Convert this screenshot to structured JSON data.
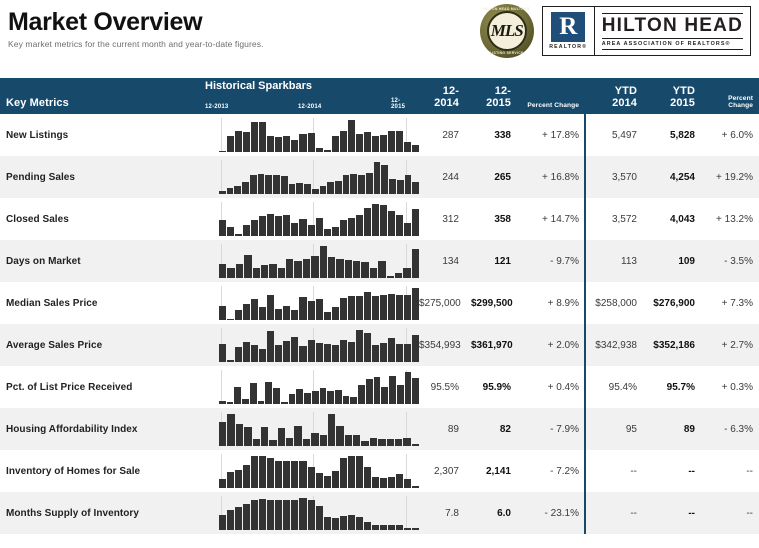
{
  "header": {
    "title": "Market Overview",
    "subtitle": "Key market metrics for the current month and year-to-date figures.",
    "logos": {
      "mls_seal": {
        "letters": "MLS",
        "top_text": "HILTON HEAD MULTIPLE",
        "bottom_text": "LISTING SERVICE"
      },
      "realtor": {
        "mark_letter": "R",
        "mark_word": "REALTOR®",
        "name": "HILTON HEAD",
        "subtitle": "AREA ASSOCIATION OF REALTORS®"
      }
    }
  },
  "table": {
    "columns": {
      "metric": "Key Metrics",
      "sparkbars": "Historical Sparkbars",
      "spark_dates": [
        "12-2013",
        "12-2014",
        "12-2015"
      ],
      "month_prior": "12-2014",
      "month_current": "12-2015",
      "month_pct": "Percent Change",
      "ytd_prior": "YTD 2014",
      "ytd_current": "YTD 2015",
      "ytd_pct": "Percent Change"
    },
    "colors": {
      "header_bg": "#17496b",
      "row_alt_bg": "#f1f1f1",
      "bar": "#333333",
      "divider": "#17496b"
    },
    "rows": [
      {
        "metric": "New Listings",
        "month_prior": "287",
        "month_current": "338",
        "month_pct": "+ 17.8%",
        "ytd_prior": "5,497",
        "ytd_current": "5,828",
        "ytd_pct": "+ 6.0%",
        "spark": [
          3,
          38,
          52,
          49,
          72,
          74,
          40,
          36,
          38,
          30,
          45,
          46,
          10,
          5,
          40,
          50,
          78,
          44,
          48,
          40,
          42,
          52,
          50,
          24,
          18
        ]
      },
      {
        "metric": "Pending Sales",
        "month_prior": "244",
        "month_current": "265",
        "month_pct": "+ 16.8%",
        "ytd_prior": "3,570",
        "ytd_current": "4,254",
        "ytd_pct": "+ 19.2%",
        "spark": [
          6,
          14,
          20,
          28,
          46,
          48,
          44,
          44,
          42,
          24,
          26,
          24,
          12,
          18,
          28,
          30,
          46,
          48,
          44,
          50,
          76,
          70,
          36,
          34,
          44,
          28
        ]
      },
      {
        "metric": "Closed Sales",
        "month_prior": "312",
        "month_current": "358",
        "month_pct": "+ 14.7%",
        "ytd_prior": "3,572",
        "ytd_current": "4,043",
        "ytd_pct": "+ 13.2%",
        "spark": [
          34,
          20,
          4,
          24,
          36,
          44,
          48,
          44,
          46,
          28,
          38,
          24,
          40,
          16,
          20,
          34,
          40,
          46,
          62,
          70,
          68,
          54,
          46,
          28,
          58
        ]
      },
      {
        "metric": "Days on Market",
        "month_prior": "134",
        "month_current": "121",
        "month_pct": "- 9.7%",
        "ytd_prior": "113",
        "ytd_current": "109",
        "ytd_pct": "- 3.5%",
        "spark": [
          24,
          18,
          24,
          40,
          18,
          22,
          24,
          18,
          34,
          30,
          34,
          38,
          56,
          36,
          34,
          32,
          30,
          28,
          18,
          30,
          4,
          8,
          18,
          50
        ]
      },
      {
        "metric": "Median Sales Price",
        "month_prior": "$275,000",
        "month_current": "$299,500",
        "month_pct": "+ 8.9%",
        "ytd_prior": "$258,000",
        "ytd_current": "$276,900",
        "ytd_pct": "+ 7.3%",
        "spark": [
          30,
          3,
          22,
          34,
          44,
          28,
          54,
          24,
          30,
          22,
          48,
          40,
          44,
          16,
          28,
          46,
          52,
          50,
          60,
          52,
          54,
          56,
          54,
          54,
          68
        ]
      },
      {
        "metric": "Average Sales Price",
        "month_prior": "$354,993",
        "month_current": "$361,970",
        "month_pct": "+ 2.0%",
        "ytd_prior": "$342,938",
        "ytd_current": "$352,186",
        "ytd_pct": "+ 2.7%",
        "spark": [
          36,
          4,
          30,
          40,
          34,
          26,
          62,
          34,
          42,
          50,
          32,
          44,
          38,
          36,
          34,
          44,
          40,
          64,
          58,
          34,
          38,
          48,
          36,
          36,
          54
        ]
      },
      {
        "metric": "Pct. of List Price Received",
        "month_prior": "95.5%",
        "month_current": "95.9%",
        "month_pct": "+ 0.4%",
        "ytd_prior": "95.4%",
        "ytd_current": "95.7%",
        "ytd_pct": "+ 0.3%",
        "spark": [
          6,
          5,
          36,
          10,
          44,
          6,
          46,
          32,
          4,
          20,
          30,
          22,
          26,
          34,
          26,
          28,
          16,
          14,
          40,
          52,
          56,
          36,
          58,
          40,
          66,
          54
        ]
      },
      {
        "metric": "Housing Affordability Index",
        "month_prior": "89",
        "month_current": "82",
        "month_pct": "- 7.9%",
        "ytd_prior": "95",
        "ytd_current": "89",
        "ytd_pct": "- 6.3%",
        "spark": [
          46,
          62,
          42,
          36,
          14,
          36,
          12,
          34,
          16,
          38,
          14,
          26,
          22,
          62,
          38,
          22,
          22,
          10,
          16,
          14,
          14,
          14,
          16,
          4
        ]
      },
      {
        "metric": "Inventory of Homes for Sale",
        "month_prior": "2,307",
        "month_current": "2,141",
        "month_pct": "- 7.2%",
        "ytd_prior": "--",
        "ytd_current": "--",
        "ytd_pct": "--",
        "spark": [
          14,
          26,
          30,
          38,
          52,
          52,
          48,
          44,
          44,
          44,
          44,
          34,
          24,
          20,
          28,
          48,
          52,
          52,
          34,
          18,
          16,
          18,
          22,
          14,
          4
        ]
      },
      {
        "metric": "Months Supply of Inventory",
        "month_prior": "7.8",
        "month_current": "6.0",
        "month_pct": "- 23.1%",
        "ytd_prior": "--",
        "ytd_current": "--",
        "ytd_pct": "--",
        "spark": [
          30,
          38,
          44,
          50,
          58,
          60,
          58,
          58,
          58,
          58,
          62,
          58,
          46,
          26,
          24,
          28,
          30,
          26,
          16,
          10,
          10,
          10,
          10,
          4,
          3
        ]
      }
    ]
  }
}
